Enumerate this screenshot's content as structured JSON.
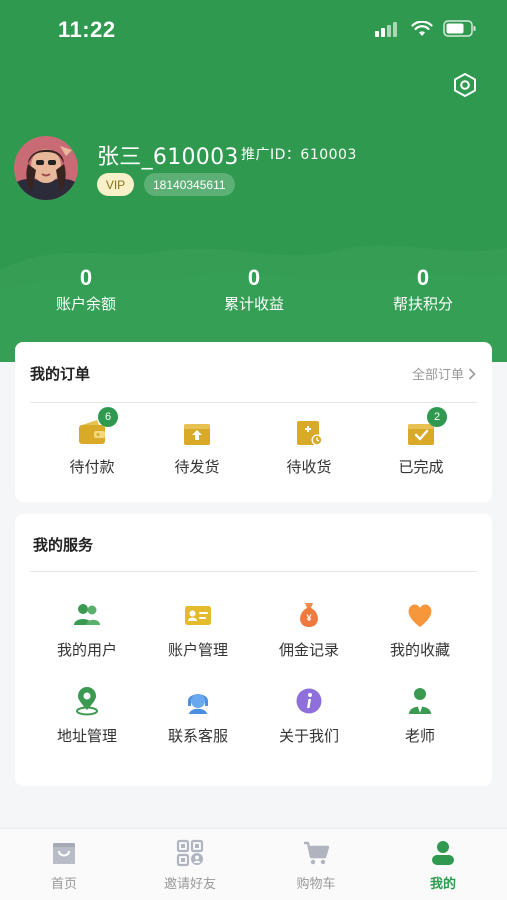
{
  "status_bar": {
    "time": "11:22"
  },
  "profile": {
    "username": "张三_610003",
    "promo_id_label": "推广ID：",
    "promo_id": "610003",
    "vip": "VIP",
    "phone": "18140345611"
  },
  "stats": [
    {
      "value": "0",
      "label": "账户余额"
    },
    {
      "value": "0",
      "label": "累计收益"
    },
    {
      "value": "0",
      "label": "帮扶积分"
    }
  ],
  "orders": {
    "title": "我的订单",
    "all_label": "全部订单",
    "items": [
      {
        "label": "待付款",
        "badge": "6",
        "icon": "wallet-icon"
      },
      {
        "label": "待发货",
        "badge": "",
        "icon": "ship-box-icon"
      },
      {
        "label": "待收货",
        "badge": "",
        "icon": "receive-box-icon"
      },
      {
        "label": "已完成",
        "badge": "2",
        "icon": "completed-box-icon"
      }
    ]
  },
  "services": {
    "title": "我的服务",
    "items": [
      {
        "label": "我的用户",
        "icon": "users-icon"
      },
      {
        "label": "账户管理",
        "icon": "id-card-icon"
      },
      {
        "label": "佣金记录",
        "icon": "money-bag-icon"
      },
      {
        "label": "我的收藏",
        "icon": "heart-icon"
      },
      {
        "label": "地址管理",
        "icon": "location-icon"
      },
      {
        "label": "联系客服",
        "icon": "customer-service-icon"
      },
      {
        "label": "关于我们",
        "icon": "info-icon"
      },
      {
        "label": "老师",
        "icon": "teacher-icon"
      }
    ]
  },
  "tabbar": [
    {
      "label": "首页",
      "icon": "home-bag-icon",
      "active": false
    },
    {
      "label": "邀请好友",
      "icon": "qr-code-icon",
      "active": false
    },
    {
      "label": "购物车",
      "icon": "cart-icon",
      "active": false
    },
    {
      "label": "我的",
      "icon": "profile-icon",
      "active": true
    }
  ],
  "colors": {
    "brand_green": "#2f9a4f",
    "order_icon_gold": "#d9a928",
    "badge_green": "#2f9a4f"
  }
}
